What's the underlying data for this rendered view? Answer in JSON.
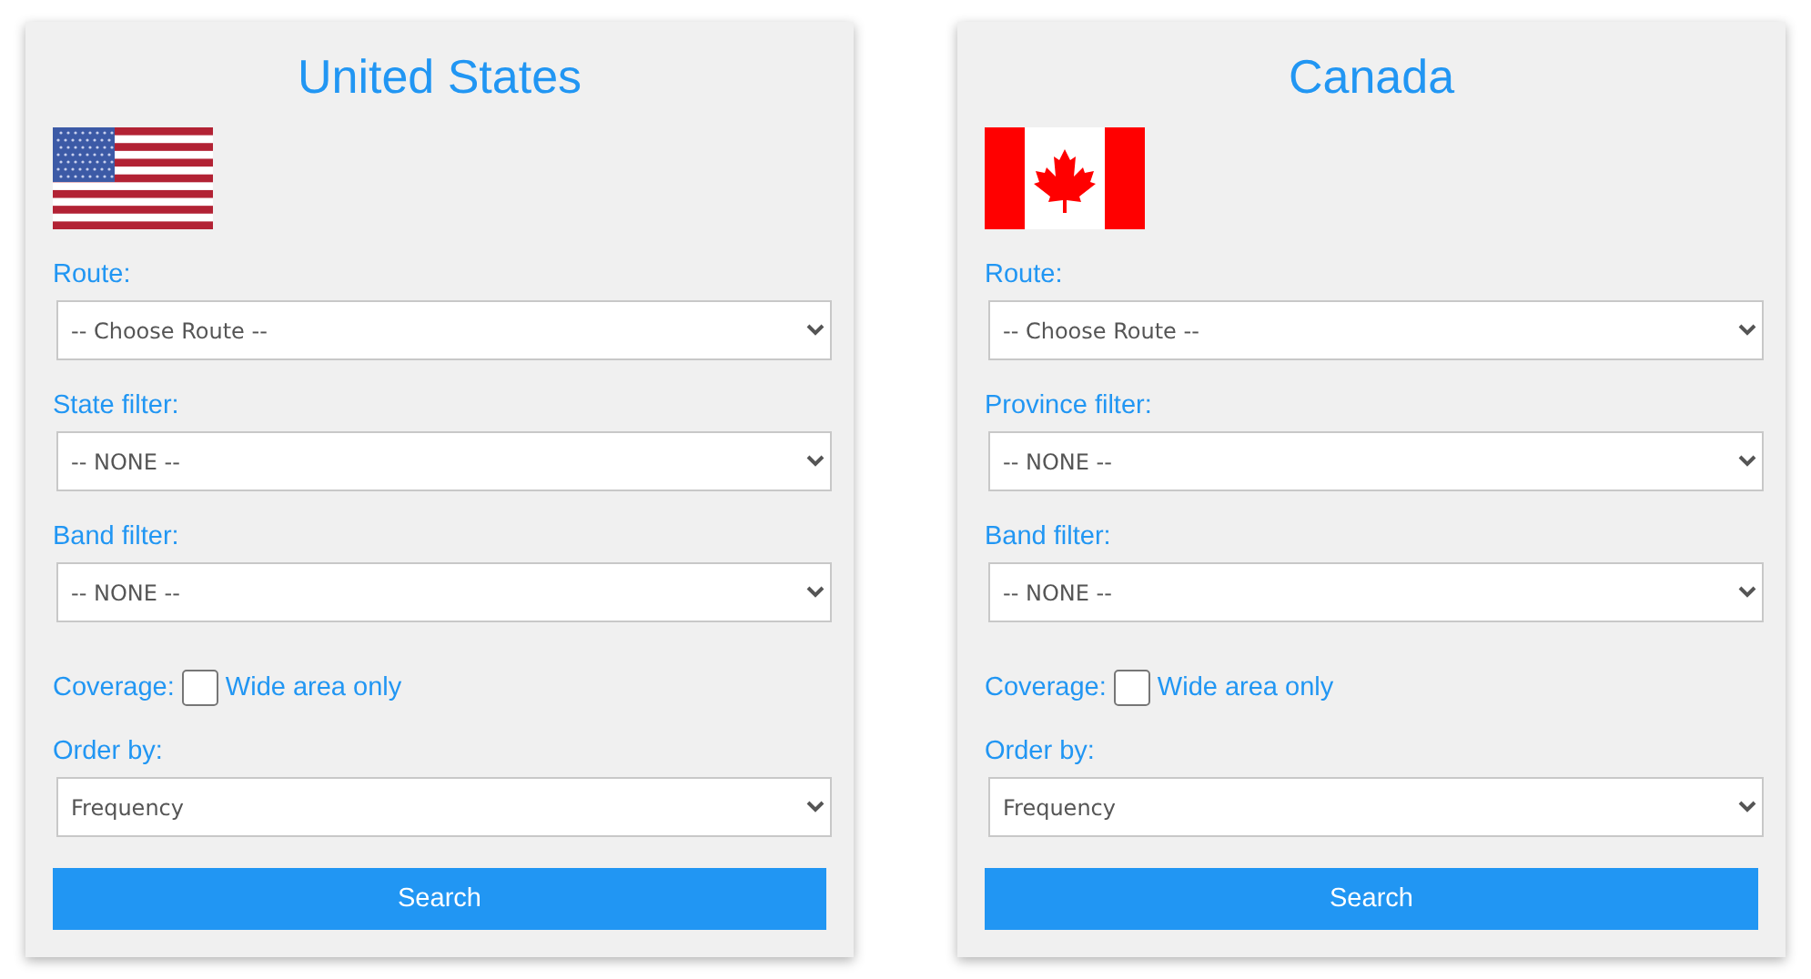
{
  "panels": [
    {
      "title": "United States",
      "flag": {
        "kind": "us"
      },
      "fields": [
        {
          "label": "Route:",
          "value": "-- Choose Route --"
        },
        {
          "label": "State filter:",
          "value": "-- NONE --"
        },
        {
          "label": "Band filter:",
          "value": "-- NONE --"
        }
      ],
      "coverage": {
        "label": "Coverage:",
        "option": "Wide area only",
        "checked": false
      },
      "order": {
        "label": "Order by:",
        "value": "Frequency"
      },
      "button": "Search"
    },
    {
      "title": "Canada",
      "flag": {
        "kind": "ca"
      },
      "fields": [
        {
          "label": "Route:",
          "value": "-- Choose Route --"
        },
        {
          "label": "Province filter:",
          "value": "-- NONE --"
        },
        {
          "label": "Band filter:",
          "value": "-- NONE --"
        }
      ],
      "coverage": {
        "label": "Coverage:",
        "option": "Wide area only",
        "checked": false
      },
      "order": {
        "label": "Order by:",
        "value": "Frequency"
      },
      "button": "Search"
    }
  ]
}
